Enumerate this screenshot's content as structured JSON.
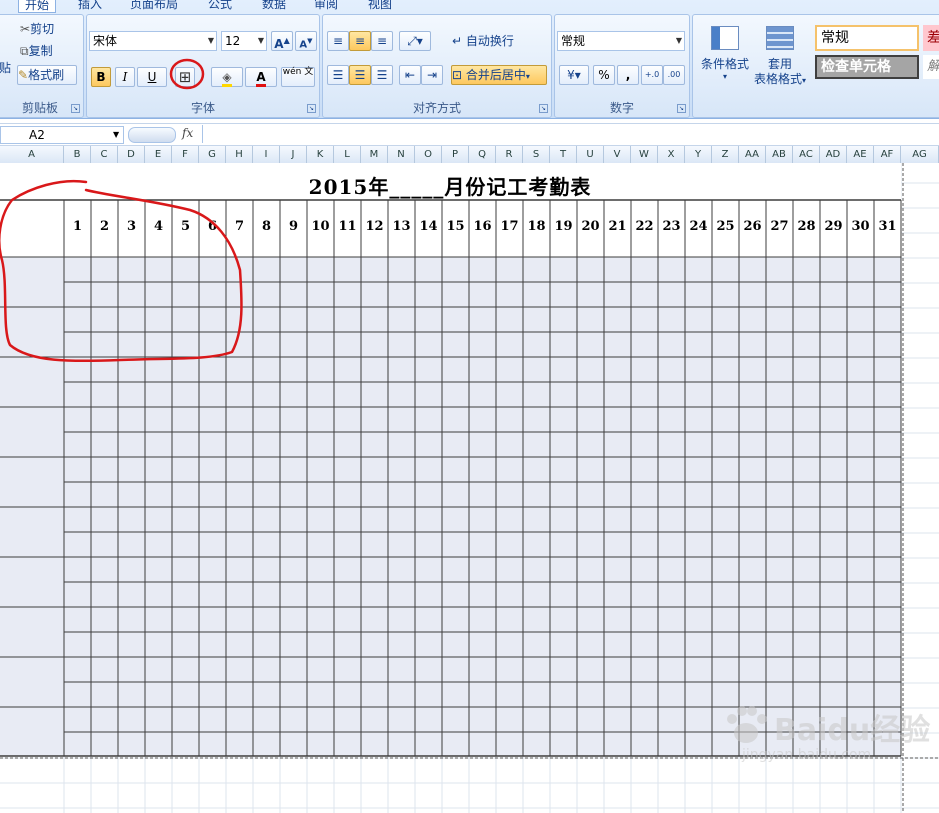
{
  "ribbon": {
    "tabs": [
      "开始",
      "插入",
      "页面布局",
      "公式",
      "数据",
      "审阅",
      "视图"
    ],
    "clipboard": {
      "cut": "剪切",
      "copy": "复制",
      "format_painter": "格式刷",
      "paste_partial": "贴",
      "label": "剪贴板"
    },
    "font": {
      "name": "宋体",
      "size": "12",
      "grow": "A",
      "shrink": "A",
      "bold": "B",
      "italic": "I",
      "underline": "U",
      "font_color_glyph": "A",
      "phonetic_glyph": "wén 文",
      "label": "字体"
    },
    "alignment": {
      "wrap": "自动换行",
      "merge": "合并后居中",
      "label": "对齐方式"
    },
    "number": {
      "format": "常规",
      "percent": "%",
      "comma": ",",
      "label": "数字"
    },
    "styles": {
      "conditional": "条件格式",
      "table_format_1": "套用",
      "table_format_2": "表格格式",
      "style_normal": "常规",
      "style_check": "检查单元格",
      "style_bad_partial": "差",
      "style_partial_2": "解"
    }
  },
  "formula_bar": {
    "name_box": "A2",
    "fx": "fx",
    "content": ""
  },
  "columns": [
    "A",
    "B",
    "C",
    "D",
    "E",
    "F",
    "G",
    "H",
    "I",
    "J",
    "K",
    "L",
    "M",
    "N",
    "O",
    "P",
    "Q",
    "R",
    "S",
    "T",
    "U",
    "V",
    "W",
    "X",
    "Y",
    "Z",
    "AA",
    "AB",
    "AC",
    "AD",
    "AE",
    "AF",
    "AG"
  ],
  "sheet": {
    "title": "2015年_____月份记工考勤表",
    "days": [
      "1",
      "2",
      "3",
      "4",
      "5",
      "6",
      "7",
      "8",
      "9",
      "10",
      "11",
      "12",
      "13",
      "14",
      "15",
      "16",
      "17",
      "18",
      "19",
      "20",
      "21",
      "22",
      "23",
      "24",
      "25",
      "26",
      "27",
      "28",
      "29",
      "30",
      "31"
    ]
  },
  "watermark": {
    "text": "Baidu经验",
    "url": "jingyan.baidu.com"
  },
  "colors": {
    "grid_fill": "#e8ebf4",
    "grid_line": "#3d3d3d",
    "annotation": "#d9181a",
    "ribbon_bg": "#d6e5f8"
  }
}
